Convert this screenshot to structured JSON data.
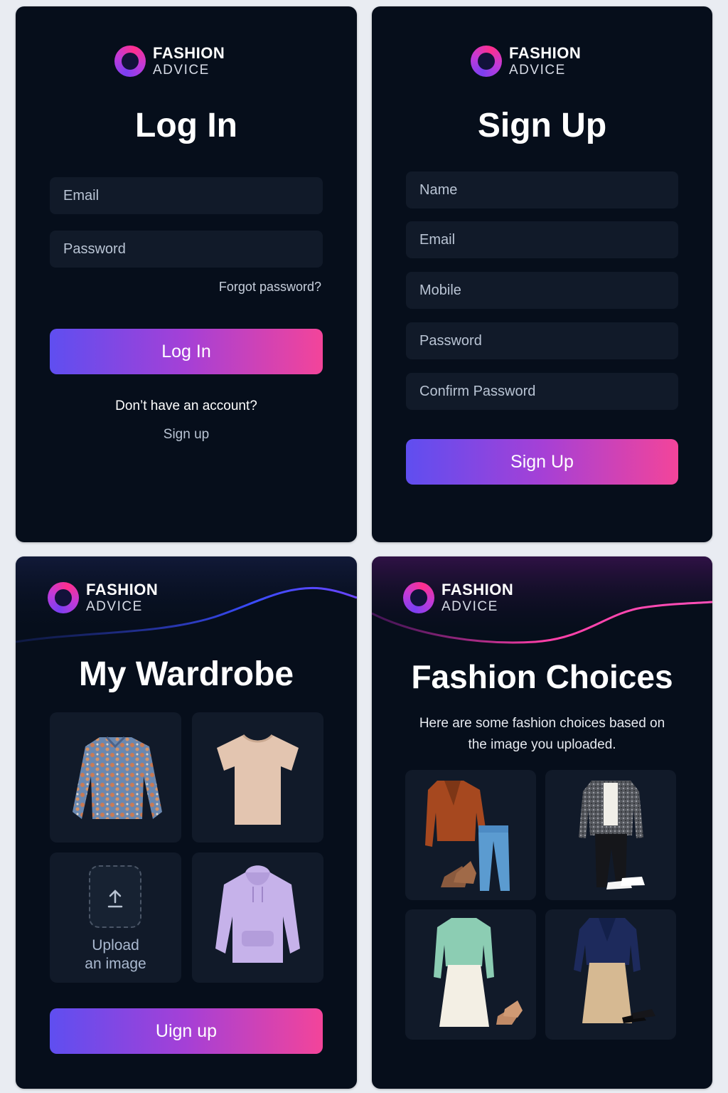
{
  "brand": {
    "line1": "FASHION",
    "line2": "ADVICE"
  },
  "login": {
    "title": "Log In",
    "email_placeholder": "Email",
    "password_placeholder": "Password",
    "forgot": "Forgot password?",
    "button": "Log In",
    "no_account": "Don’t have an account?",
    "signup_link": "Sign up"
  },
  "signup": {
    "title": "Sign Up",
    "fields": [
      "Name",
      "Email",
      "Mobile",
      "Password",
      "Confirm Password"
    ],
    "button": "Sign Up"
  },
  "wardrobe": {
    "title": "My Wardrobe",
    "items": [
      {
        "name": "floral-blouse-image"
      },
      {
        "name": "beige-tshirt-image"
      },
      {
        "name": "upload-image-tile"
      },
      {
        "name": "lavender-hoodie-image"
      }
    ],
    "upload_line1": "Upload",
    "upload_line2": "an image",
    "button": "Uign up"
  },
  "choices": {
    "title": "Fashion Choices",
    "subtitle_line1": "Here are some fashion choices based on",
    "subtitle_line2": "the image you uploaded.",
    "outfits": [
      {
        "name": "outfit-rust-jacket-jeans"
      },
      {
        "name": "outfit-tweed-blazer-sneakers"
      },
      {
        "name": "outfit-mint-sweater-skirt"
      },
      {
        "name": "outfit-navy-blazer-skirt"
      }
    ]
  },
  "colors": {
    "background": "#e9ecf2",
    "card": "#060e1b",
    "field": "#111a29",
    "gradient_start": "#5f4ef0",
    "gradient_end": "#f3449a"
  }
}
